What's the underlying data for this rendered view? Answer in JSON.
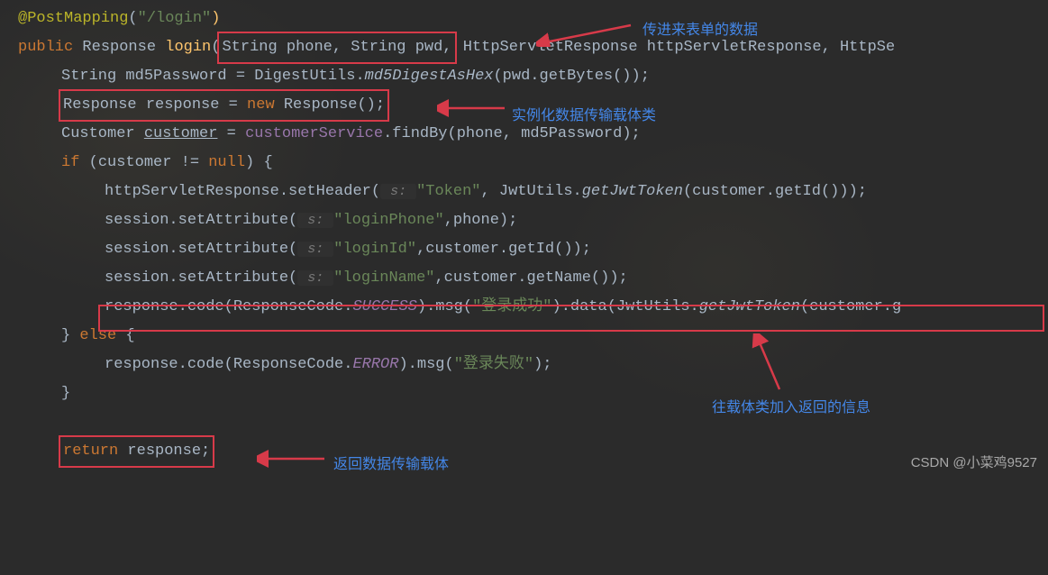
{
  "annotations": {
    "label1": "传进来表单的数据",
    "label2": "实例化数据传输载体类",
    "label3": "往载体类加入返回的信息",
    "label4": "返回数据传输载体"
  },
  "watermark": "CSDN @小菜鸡9527",
  "code": {
    "l1_annotation": "@PostMapping",
    "l1_paren_open": "(",
    "l1_string": "\"/login\"",
    "l1_paren_close": ")",
    "l2_public": "public",
    "l2_resptype": " Response ",
    "l2_method": "login",
    "l2_po": "(",
    "l2_params_boxed": "String phone, String pwd,",
    "l2_rest": " HttpServletResponse httpServletResponse, HttpSe",
    "l3_pre": "String md5Password = DigestUtils.",
    "l3_md5": "md5DigestAsHex",
    "l3_post": "(pwd.getBytes());",
    "l4_pre": "Response response = ",
    "l4_new": "new",
    "l4_post": " Response();",
    "l5_pre": "Customer ",
    "l5_cust": "customer",
    "l5_mid": " = ",
    "l5_svc": "customerService",
    "l5_post": ".findBy(phone, md5Password);",
    "l6_if": "if",
    "l6_cond_open": " (",
    "l6_cond": "customer != ",
    "l6_null": "null",
    "l6_cond_close": ") {",
    "l7_pre": "httpServletResponse.setHeader(",
    "l7_hint": " s: ",
    "l7_str": "\"Token\"",
    "l7_mid": ", JwtUtils.",
    "l7_gjt": "getJwtToken",
    "l7_post": "(customer.getId()));",
    "l8_pre": "session.setAttribute(",
    "l8_hint": " s: ",
    "l8_str": "\"loginPhone\"",
    "l8_post": ",phone);",
    "l9_pre": "session.setAttribute(",
    "l9_hint": " s: ",
    "l9_str": "\"loginId\"",
    "l9_post": ",customer.getId());",
    "l10_pre": "session.setAttribute(",
    "l10_hint": " s: ",
    "l10_str": "\"loginName\"",
    "l10_post": ",customer.getName());",
    "l11_pre": "response.code(ResponseCode.",
    "l11_success": "SUCCESS",
    "l11_mid1": ").msg(",
    "l11_str": "\"登录成功\"",
    "l11_mid2": ").data(JwtUtils.",
    "l11_gjt": "getJwtToken",
    "l11_post": "(customer.g",
    "l12_close": "} ",
    "l12_else": "else",
    "l12_open": " {",
    "l13_pre": "response.code(ResponseCode.",
    "l13_error": "ERROR",
    "l13_mid": ").msg(",
    "l13_str": "\"登录失败\"",
    "l13_post": ");",
    "l14_close": "}",
    "l16_return": "return",
    "l16_post": " response;"
  }
}
